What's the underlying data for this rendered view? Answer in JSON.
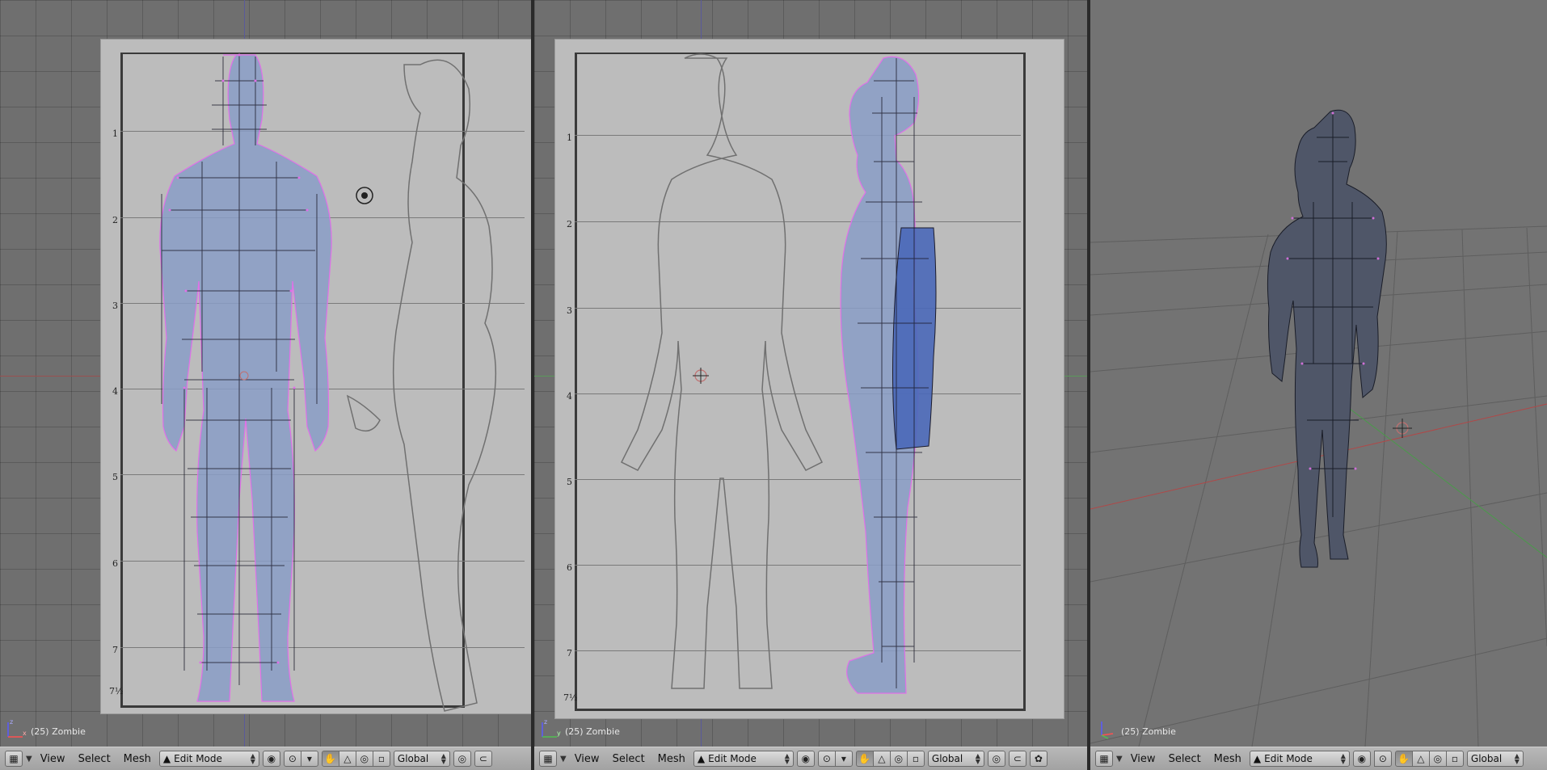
{
  "viewports": [
    {
      "id": "front",
      "object_label": "(25) Zombie"
    },
    {
      "id": "side",
      "object_label": "(25) Zombie"
    },
    {
      "id": "persp",
      "object_label": "(25) Zombie"
    }
  ],
  "ruler_numbers": [
    "1",
    "2",
    "3",
    "4",
    "5",
    "6",
    "7",
    "7½"
  ],
  "header": {
    "view_menu": "View",
    "select_menu": "Select",
    "mesh_menu": "Mesh",
    "mode": "Edit Mode",
    "orientation": "Global"
  },
  "icons": {
    "editor_type": "grid-icon",
    "menu_toggle": "triangle-icon",
    "mode": "mesh-icon",
    "pivot": "pivot-icon",
    "manipulator": "hand-icon",
    "snap": "magnet-icon"
  },
  "colors": {
    "mesh_fill": "#8a9dc7",
    "mesh_wire": "#1b1b2b",
    "vertex": "#e070e8",
    "selected_face": "#4a68b8",
    "x_axis": "#c05050",
    "y_axis": "#50a050"
  }
}
